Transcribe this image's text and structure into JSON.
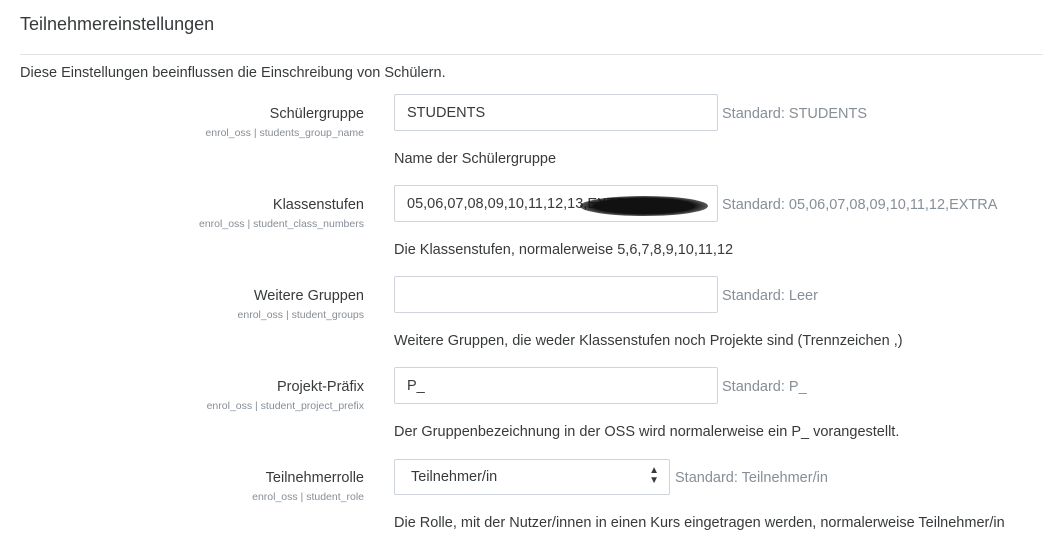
{
  "section": {
    "title": "Teilnehmereinstellungen",
    "intro": "Diese Einstellungen beeinflussen die Einschreibung von Schülern."
  },
  "settings": [
    {
      "label": "Schülergruppe",
      "key": "enrol_oss | students_group_name",
      "value": "STUDENTS",
      "default": "Standard: STUDENTS",
      "description": "Name der Schülergruppe"
    },
    {
      "label": "Klassenstufen",
      "key": "enrol_oss | student_class_numbers",
      "value": "05,06,07,08,09,10,11,12,13,EXTRA",
      "default": "Standard: 05,06,07,08,09,10,11,12,EXTRA",
      "description": "Die Klassenstufen, normalerweise 5,6,7,8,9,10,11,12"
    },
    {
      "label": "Weitere Gruppen",
      "key": "enrol_oss | student_groups",
      "value": "",
      "default": "Standard: Leer",
      "description": "Weitere Gruppen, die weder Klassenstufen noch Projekte sind (Trennzeichen ,)"
    },
    {
      "label": "Projekt-Präfix",
      "key": "enrol_oss | student_project_prefix",
      "value": "P_",
      "default": "Standard: P_",
      "description": "Der Gruppenbezeichnung in der OSS wird normalerweise ein P_ vorangestellt."
    },
    {
      "label": "Teilnehmerrolle",
      "key": "enrol_oss | student_role",
      "value": "Teilnehmer/in",
      "default": "Standard: Teilnehmer/in",
      "description": "Die Rolle, mit der Nutzer/innen in einen Kurs eingetragen werden, normalerweise Teilnehmer/in"
    }
  ],
  "icons": {
    "select_arrow": "sort-arrows-icon"
  }
}
